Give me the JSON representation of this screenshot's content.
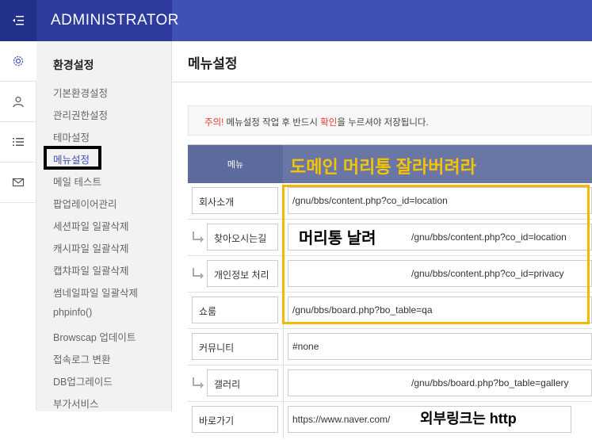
{
  "header": {
    "admin_title": "ADMINISTRATOR"
  },
  "rail": {
    "items": [
      "gear-icon",
      "user-icon",
      "list-icon",
      "mail-icon"
    ]
  },
  "sidebar": {
    "title": "환경설정",
    "items": [
      {
        "label": "기본환경설정"
      },
      {
        "label": "관리권한설정"
      },
      {
        "label": "테마설정"
      },
      {
        "label": "메뉴설정"
      },
      {
        "label": "메일 테스트"
      },
      {
        "label": "팝업레이어관리"
      },
      {
        "label": "세션파일 일괄삭제"
      },
      {
        "label": "캐시파일 일괄삭제"
      },
      {
        "label": "캡챠파일 일괄삭제"
      },
      {
        "label": "썸네일파일 일괄삭제"
      },
      {
        "label": "phpinfo()"
      },
      {
        "label": "Browscap 업데이트"
      },
      {
        "label": "접속로그 변환"
      },
      {
        "label": "DB업그레이드"
      },
      {
        "label": "부가서비스"
      }
    ],
    "selected_index": 3
  },
  "main": {
    "page_title": "메뉴설정",
    "notice": {
      "part1": "주의!",
      "part2": " 메뉴설정 작업 후 반드시 ",
      "part3": "확인",
      "part4": "을 누르셔야 저장됩니다."
    },
    "table": {
      "header_menu": "메뉴",
      "rows": [
        {
          "name": "회사소개",
          "url": "/gnu/bbs/content.php?co_id=location",
          "sub": false
        },
        {
          "name": "찾아오시는길",
          "url": "/gnu/bbs/content.php?co_id=location",
          "sub": true
        },
        {
          "name": "개인정보 처리",
          "url": "/gnu/bbs/content.php?co_id=privacy",
          "sub": true
        },
        {
          "name": "쇼룸",
          "url": "/gnu/bbs/board.php?bo_table=qa",
          "sub": false
        },
        {
          "name": "커뮤니티",
          "url": "#none",
          "sub": false
        },
        {
          "name": "갤러리",
          "url": "/gnu/bbs/board.php?bo_table=gallery",
          "sub": true
        },
        {
          "name": "바로가기",
          "url": "https://www.naver.com/",
          "sub": false
        }
      ]
    }
  },
  "annotations": {
    "header_note": "도메인 머리통 잘라버려라",
    "middle_note": "머리통 날려",
    "bottom_note": "외부링크는 http",
    "highlight_color": "#f5b800"
  }
}
